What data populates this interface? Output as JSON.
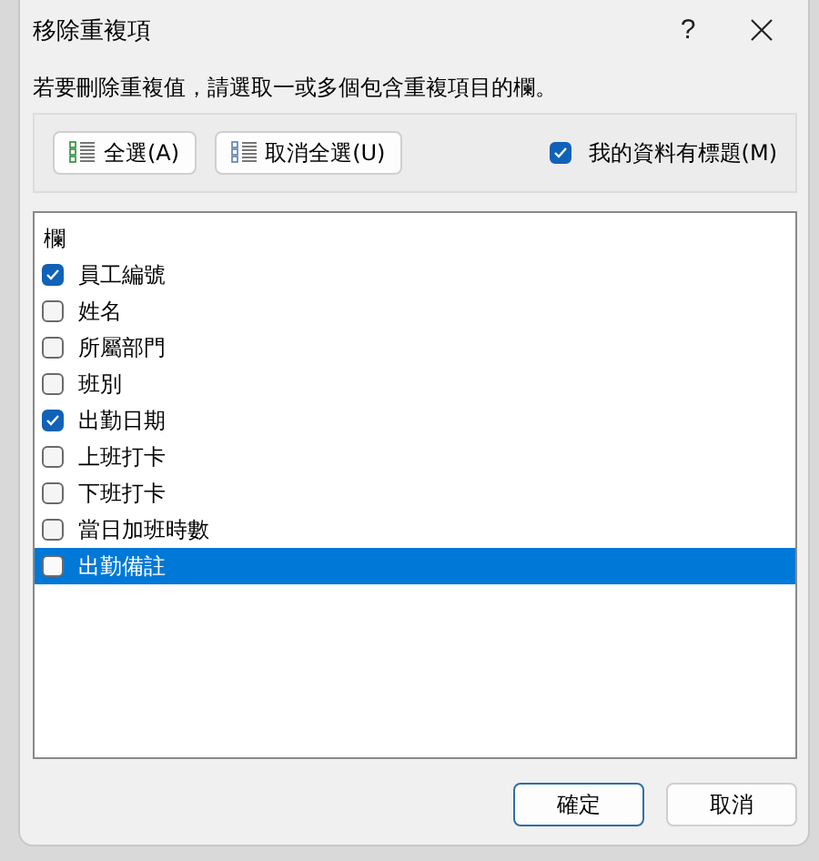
{
  "window": {
    "title": "移除重複項",
    "help": "?"
  },
  "instruction": "若要刪除重複值，請選取一或多個包含重複項目的欄。",
  "toolbar": {
    "select_all": "全選(A)",
    "unselect_all": "取消全選(U)",
    "has_headers": {
      "label": "我的資料有標題(M)",
      "checked": true
    }
  },
  "list": {
    "header": "欄",
    "items": [
      {
        "label": "員工編號",
        "checked": true,
        "selected": false
      },
      {
        "label": "姓名",
        "checked": false,
        "selected": false
      },
      {
        "label": "所屬部門",
        "checked": false,
        "selected": false
      },
      {
        "label": "班別",
        "checked": false,
        "selected": false
      },
      {
        "label": "出勤日期",
        "checked": true,
        "selected": false
      },
      {
        "label": "上班打卡",
        "checked": false,
        "selected": false
      },
      {
        "label": "下班打卡",
        "checked": false,
        "selected": false
      },
      {
        "label": "當日加班時數",
        "checked": false,
        "selected": false
      },
      {
        "label": "出勤備註",
        "checked": false,
        "selected": true
      }
    ]
  },
  "buttons": [
    {
      "label": "確定",
      "default": true
    },
    {
      "label": "取消",
      "default": false
    }
  ]
}
